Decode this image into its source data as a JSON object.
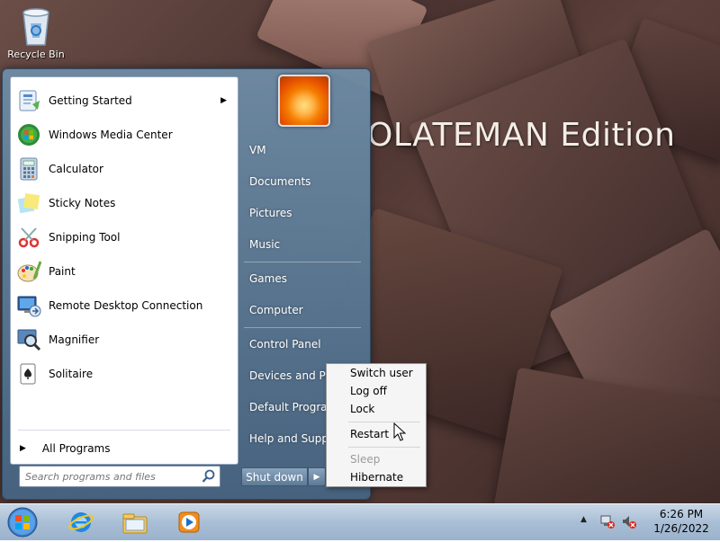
{
  "desktop": {
    "wallpaper_text": "OLATEMAN Edition",
    "icons": [
      {
        "label": "Recycle Bin",
        "icon": "recycle-bin-icon"
      }
    ]
  },
  "start_menu": {
    "programs": [
      {
        "label": "Getting Started",
        "icon": "getting-started-icon",
        "has_submenu": true
      },
      {
        "label": "Windows Media Center",
        "icon": "windows-media-center-icon"
      },
      {
        "label": "Calculator",
        "icon": "calculator-icon"
      },
      {
        "label": "Sticky Notes",
        "icon": "sticky-notes-icon"
      },
      {
        "label": "Snipping Tool",
        "icon": "snipping-tool-icon"
      },
      {
        "label": "Paint",
        "icon": "paint-icon"
      },
      {
        "label": "Remote Desktop Connection",
        "icon": "remote-desktop-icon"
      },
      {
        "label": "Magnifier",
        "icon": "magnifier-icon"
      },
      {
        "label": "Solitaire",
        "icon": "solitaire-icon"
      }
    ],
    "all_programs": "All Programs",
    "search": {
      "placeholder": "Search programs and files"
    },
    "right_items": [
      "VM",
      "Documents",
      "Pictures",
      "Music",
      "Games",
      "Computer",
      "Control Panel",
      "Devices and Printers",
      "Default Programs",
      "Help and Support"
    ],
    "shutdown_label": "Shut down"
  },
  "power_menu": {
    "items": [
      {
        "label": "Switch user",
        "enabled": true
      },
      {
        "label": "Log off",
        "enabled": true
      },
      {
        "label": "Lock",
        "enabled": true
      },
      {
        "label": "Restart",
        "enabled": true
      },
      {
        "label": "Sleep",
        "enabled": false
      },
      {
        "label": "Hibernate",
        "enabled": true
      }
    ]
  },
  "taskbar": {
    "pinned": [
      "internet-explorer-icon",
      "windows-explorer-icon",
      "windows-media-player-icon"
    ],
    "clock": {
      "time": "6:26 PM",
      "date": "1/26/2022"
    }
  },
  "colors": {
    "accent": "#5d7a96",
    "taskbar": "#a9bfd6"
  }
}
